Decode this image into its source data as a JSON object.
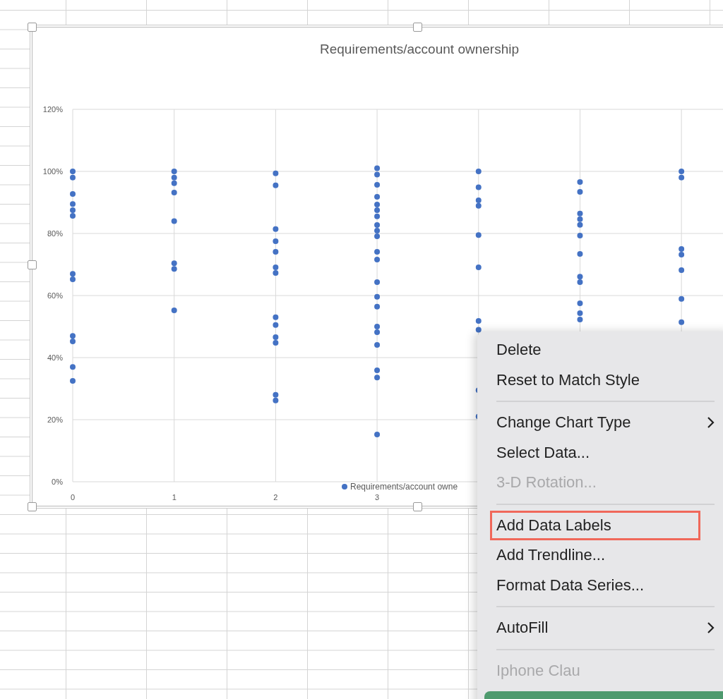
{
  "chart": {
    "chart_data": {
      "type": "scatter",
      "title": "Requirements/account ownership",
      "grid": true,
      "xlim": [
        0,
        6.5
      ],
      "ylim": [
        0,
        1.2
      ],
      "xticks": [
        0,
        1,
        2,
        3
      ],
      "yticks": [
        {
          "value": 0,
          "label": "0%"
        },
        {
          "value": 0.2,
          "label": "20%"
        },
        {
          "value": 0.4,
          "label": "40%"
        },
        {
          "value": 0.6,
          "label": "60%"
        },
        {
          "value": 0.8,
          "label": "80%"
        },
        {
          "value": 1,
          "label": "100%"
        },
        {
          "value": 1.2,
          "label": "120%"
        }
      ],
      "series": [
        {
          "name": "Requirements/account owne",
          "color": "#4472c4",
          "x": [
            0,
            0,
            0,
            0,
            0,
            0,
            0,
            0,
            0,
            0,
            0,
            0,
            1,
            1,
            1,
            1,
            1,
            1,
            1,
            1,
            2,
            2,
            2,
            2,
            2,
            2,
            2,
            2,
            2,
            2,
            2,
            2,
            2,
            3,
            3,
            3,
            3,
            3,
            3,
            3,
            3,
            3,
            3,
            3,
            3,
            3,
            3,
            3,
            3,
            3,
            3,
            3,
            3,
            3,
            4,
            4,
            4,
            4,
            4,
            4,
            4,
            4,
            4,
            4,
            5,
            5,
            5,
            5,
            5,
            5,
            5,
            5,
            5,
            5,
            5,
            5,
            6,
            6,
            6,
            6,
            6,
            6,
            6
          ],
          "values": [
            1.0,
            0.98,
            0.927,
            0.895,
            0.875,
            0.857,
            0.67,
            0.652,
            0.47,
            0.452,
            0.37,
            0.325,
            1.0,
            0.98,
            0.962,
            0.932,
            0.84,
            0.704,
            0.686,
            0.552,
            0.994,
            0.955,
            0.814,
            0.775,
            0.741,
            0.691,
            0.673,
            0.53,
            0.505,
            0.466,
            0.448,
            0.28,
            0.262,
            1.01,
            0.99,
            0.957,
            0.918,
            0.893,
            0.875,
            0.855,
            0.827,
            0.809,
            0.791,
            0.741,
            0.716,
            0.643,
            0.596,
            0.564,
            0.5,
            0.482,
            0.441,
            0.359,
            0.336,
            0.152,
            1.0,
            0.949,
            0.907,
            0.889,
            0.795,
            0.691,
            0.518,
            0.49,
            0.295,
            0.21,
            0.966,
            0.934,
            0.864,
            0.846,
            0.828,
            0.793,
            0.734,
            0.661,
            0.643,
            0.575,
            0.543,
            0.523,
            1.0,
            0.98,
            0.75,
            0.732,
            0.682,
            0.589,
            0.514
          ]
        }
      ]
    }
  },
  "context_menu": {
    "items": [
      {
        "kind": "item",
        "label": "Delete",
        "disabled": false,
        "submenu": false,
        "outlined": false
      },
      {
        "kind": "item",
        "label": "Reset to Match Style",
        "disabled": false,
        "submenu": false,
        "outlined": false
      },
      {
        "kind": "separator"
      },
      {
        "kind": "item",
        "label": "Change Chart Type",
        "disabled": false,
        "submenu": true,
        "outlined": false
      },
      {
        "kind": "item",
        "label": "Select Data...",
        "disabled": false,
        "submenu": false,
        "outlined": false
      },
      {
        "kind": "item",
        "label": "3-D Rotation...",
        "disabled": true,
        "submenu": false,
        "outlined": false
      },
      {
        "kind": "separator"
      },
      {
        "kind": "item",
        "label": "Add Data Labels",
        "disabled": false,
        "submenu": false,
        "outlined": true
      },
      {
        "kind": "item",
        "label": "Add Trendline...",
        "disabled": false,
        "submenu": false,
        "outlined": false
      },
      {
        "kind": "item",
        "label": "Format Data Series...",
        "disabled": false,
        "submenu": false,
        "outlined": false
      },
      {
        "kind": "separator"
      },
      {
        "kind": "item",
        "label": "AutoFill",
        "disabled": false,
        "submenu": true,
        "outlined": false
      },
      {
        "kind": "separator"
      },
      {
        "kind": "item",
        "label": "Iphone Clau",
        "disabled": true,
        "submenu": false,
        "outlined": false
      }
    ]
  }
}
